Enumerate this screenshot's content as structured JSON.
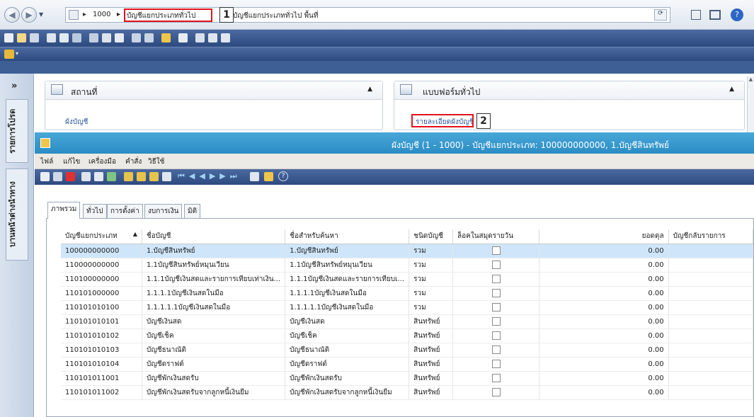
{
  "address_bar": {
    "back_icon": "back-arrow-icon",
    "forward_icon": "forward-arrow-icon",
    "crumbs": [
      "1000",
      "บัญชีแยกประเภททั่วไป",
      "บัญชีแยกประเภททั่วไป พื้นที่"
    ]
  },
  "callouts": {
    "one": "1",
    "two": "2"
  },
  "nav_pane": {
    "tabs": [
      "รายการโปรด",
      "บานหน้าต่างนำทาง"
    ]
  },
  "panels": {
    "places": {
      "title": "สถานที่",
      "link": "ผังบัญชี"
    },
    "forms": {
      "title": "แบบฟอร์มทั่วไป",
      "link": "รายละเอียดผังบัญชี"
    }
  },
  "form": {
    "title": "ผังบัญชี (1 - 1000) - บัญชีแยกประเภท: 100000000000, 1.บัญชีสินทรัพย์",
    "menu": [
      "ไฟล์",
      "แก้ไข",
      "เครื่องมือ",
      "คำสั่ง",
      "วิธีใช้"
    ],
    "tabs": [
      "ภาพรวม",
      "ทั่วไป",
      "การตั้งค่า",
      "งบการเงิน",
      "มิติ"
    ]
  },
  "grid": {
    "columns": [
      "บัญชีแยกประเภท",
      "ชื่อบัญชี",
      "ชื่อสำหรับค้นหา",
      "ชนิดบัญชี",
      "ล็อคในสมุดรายวัน",
      "ยอดดุล",
      "บัญชีกลับรายการ"
    ],
    "sort_icon": "sort-ascending-icon",
    "rows": [
      {
        "account": "100000000000",
        "name": "1.บัญชีสินทรัพย์",
        "search": "1.บัญชีสินทรัพย์",
        "type": "รวม",
        "balance": "0.00",
        "selected": true
      },
      {
        "account": "110000000000",
        "name": "1.1บัญชีสินทรัพย์หมุนเวียน",
        "search": "1.1บัญชีสินทรัพย์หมุนเวียน",
        "type": "รวม",
        "balance": "0.00"
      },
      {
        "account": "110100000000",
        "name": "1.1.1บัญชีเงินสดและรายการเทียบเท่าเงิน...",
        "search": "1.1.1บัญชีเงินสดและรายการเทียบเ...",
        "type": "รวม",
        "balance": "0.00"
      },
      {
        "account": "110101000000",
        "name": "1.1.1.1บัญชีเงินสดในมือ",
        "search": "1.1.1.1บัญชีเงินสดในมือ",
        "type": "รวม",
        "balance": "0.00"
      },
      {
        "account": "110101010100",
        "name": "1.1.1.1.1บัญชีเงินสดในมือ",
        "search": "1.1.1.1.1บัญชีเงินสดในมือ",
        "type": "รวม",
        "balance": "0.00"
      },
      {
        "account": "110101010101",
        "name": "บัญชีเงินสด",
        "search": "บัญชีเงินสด",
        "type": "สินทรัพย์",
        "balance": "0.00"
      },
      {
        "account": "110101010102",
        "name": "บัญชีเช็ค",
        "search": "บัญชีเช็ค",
        "type": "สินทรัพย์",
        "balance": "0.00"
      },
      {
        "account": "110101010103",
        "name": "บัญชีธนาณัติ",
        "search": "บัญชีธนาณัติ",
        "type": "สินทรัพย์",
        "balance": "0.00"
      },
      {
        "account": "110101010104",
        "name": "บัญชีดราฟต์",
        "search": "บัญชีดราฟต์",
        "type": "สินทรัพย์",
        "balance": "0.00"
      },
      {
        "account": "110101011001",
        "name": "บัญชีพักเงินสดรับ",
        "search": "บัญชีพักเงินสดรับ",
        "type": "สินทรัพย์",
        "balance": "0.00"
      },
      {
        "account": "110101011002",
        "name": "บัญชีพักเงินสดรับจากลูกหนี้เงินยืม",
        "search": "บัญชีพักเงินสดรับจากลูกหนี้เงินยืม",
        "type": "สินทรัพย์",
        "balance": "0.00"
      }
    ]
  },
  "colors": {
    "selection": "#cfe6fa",
    "title_bar": "#2b8cc4",
    "toolbar": "#2d4a7f",
    "callout_border": "#e0141e"
  }
}
